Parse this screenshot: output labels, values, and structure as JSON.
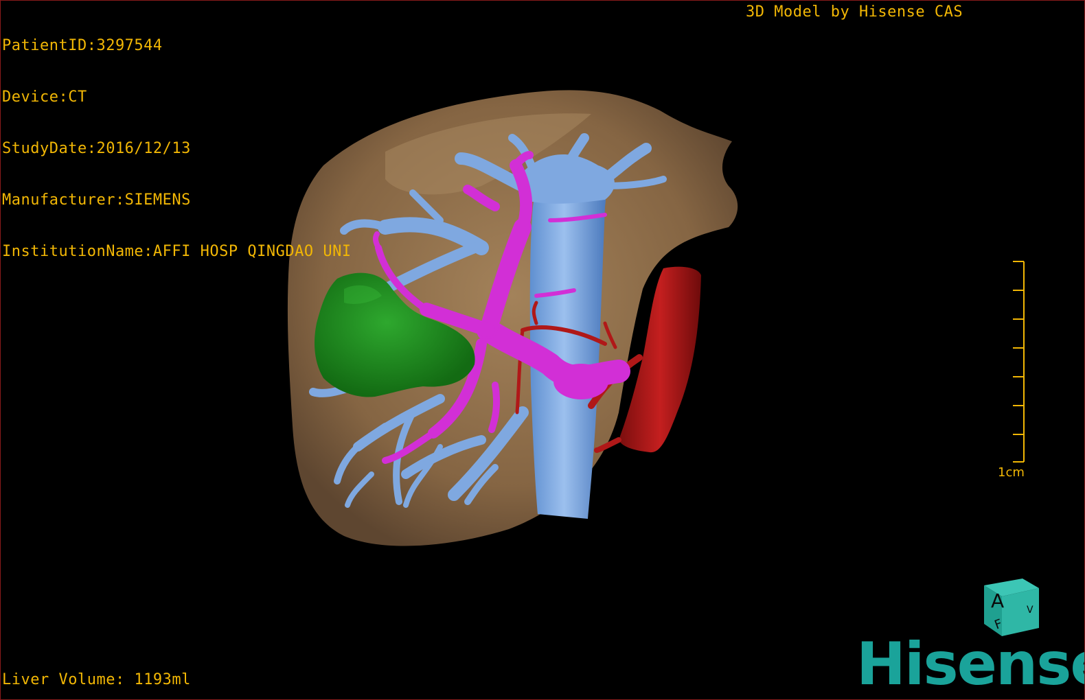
{
  "header": {
    "info_lines": [
      "PatientID:3297544",
      "Device:CT",
      "StudyDate:2016/12/13",
      "Manufacturer:SIEMENS",
      "InstitutionName:AFFI HOSP QINGDAO UNI"
    ],
    "credit": "3D Model by Hisense CAS"
  },
  "footer": {
    "volume_text": "Liver Volume: 1193ml"
  },
  "scale_bar": {
    "label": "1cm"
  },
  "orientation_cube": {
    "front_label": "A",
    "bottom_label": "F",
    "side_label": "V"
  },
  "brand": {
    "logo_text": "Hisense",
    "color": "#1aa39a"
  },
  "colors": {
    "text": "#f2b705",
    "liver": "#8a6a46",
    "hepatic_vein": "#7fa8e0",
    "portal_vein": "#d22fd6",
    "artery": "#b01818",
    "tumor": "#1e8f1e"
  }
}
